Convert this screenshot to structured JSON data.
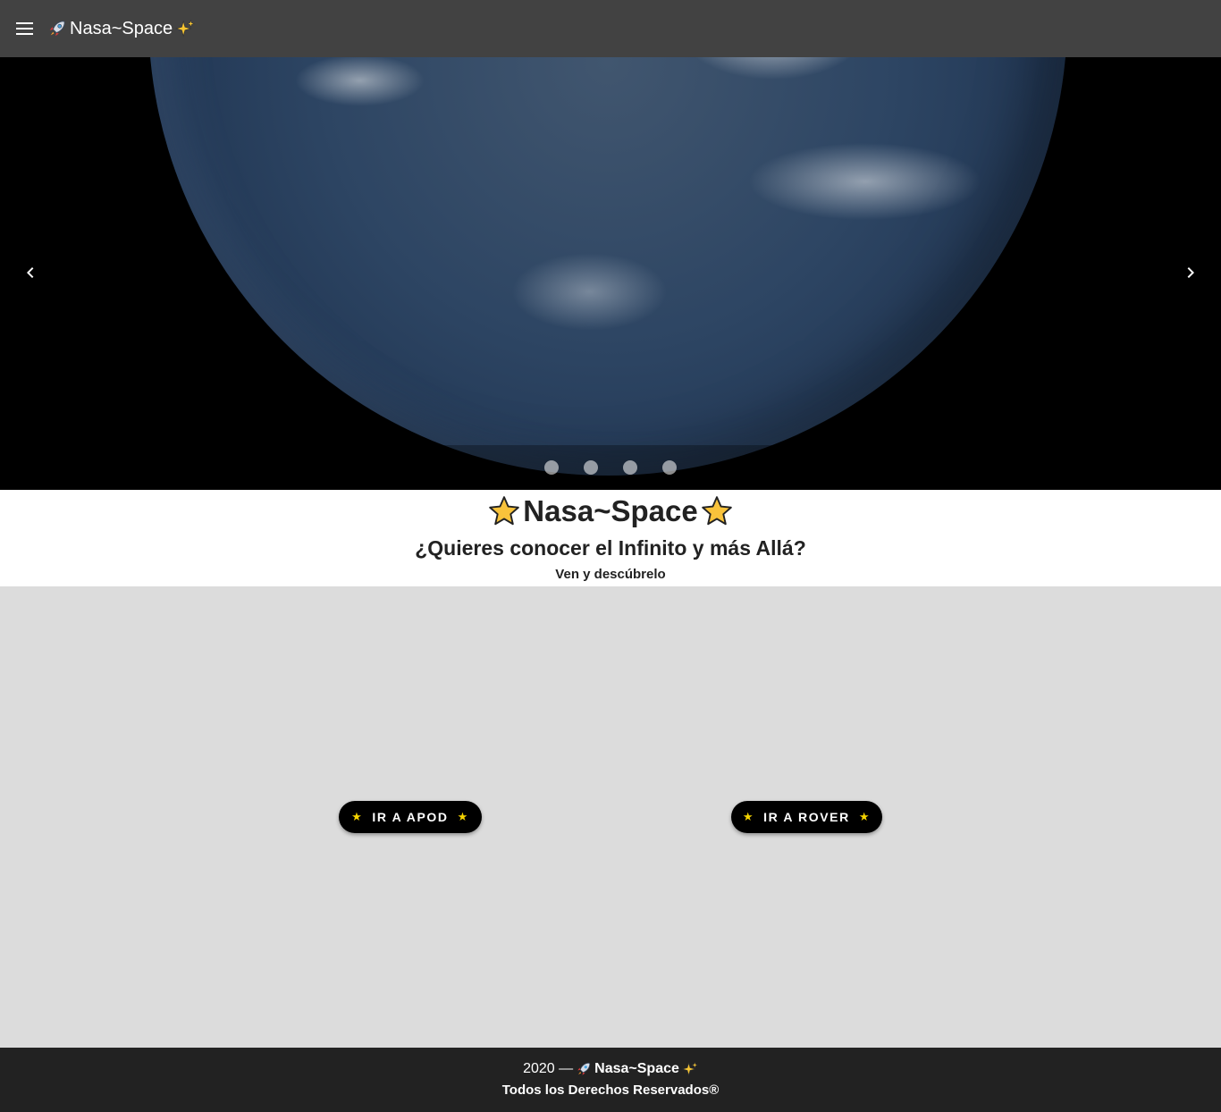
{
  "app_bar": {
    "title": "Nasa~Space",
    "leading_icon": "menu-icon",
    "title_prefix_icon": "rocket-icon",
    "title_suffix_icon": "sparkles-icon",
    "background": "#424242"
  },
  "carousel": {
    "prev_icon": "chevron-left-icon",
    "next_icon": "chevron-right-icon",
    "slide_count": 4,
    "active_index": 0
  },
  "hero": {
    "title": "Nasa~Space",
    "title_icon": "star-icon",
    "subtitle": "¿Quieres conocer el Infinito y más Allá?",
    "tagline": "Ven y descúbrelo"
  },
  "actions": {
    "apod_label": "IR A APOD",
    "rover_label": "IR A ROVER",
    "star_glyph": "★",
    "button_bg": "#000000",
    "star_color": "#f5d400",
    "section_bg": "#dcdcdc"
  },
  "footer": {
    "year_text": "2020 —",
    "brand": "Nasa~Space",
    "rights": "Todos los Derechos Reservados®",
    "background": "#222222"
  }
}
